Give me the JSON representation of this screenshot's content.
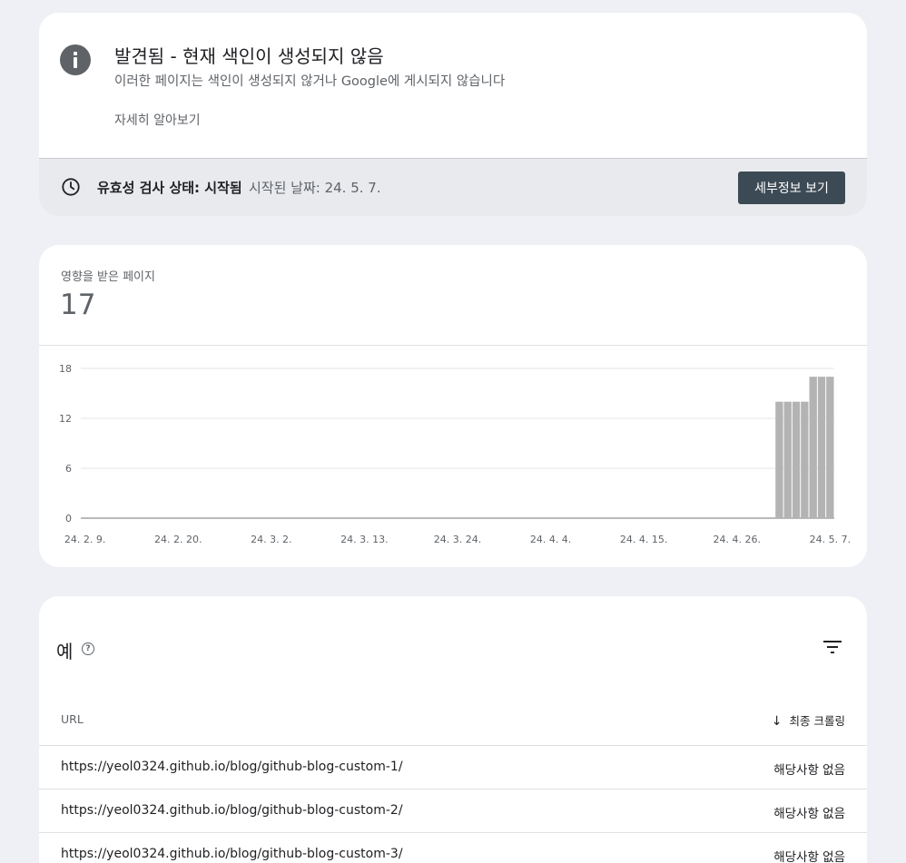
{
  "status_card": {
    "title": "발견됨 - 현재 색인이 생성되지 않음",
    "subtitle": "이러한 페이지는 색인이 생성되지 않거나 Google에 게시되지 않습니다",
    "learn_more": "자세히 알아보기",
    "validation_label": "유효성 검사 상태: 시작됨",
    "validation_date": "시작된 날짜: 24. 5. 7.",
    "details_button": "세부정보 보기"
  },
  "affected": {
    "label": "영향을 받은 페이지",
    "value": "17"
  },
  "chart_data": {
    "type": "bar",
    "title": "",
    "xlabel": "",
    "ylabel": "",
    "ylim": [
      0,
      18
    ],
    "yticks": [
      "18",
      "12",
      "6",
      "0"
    ],
    "x_tick_labels": [
      "24. 2. 9.",
      "24. 2. 20.",
      "24. 3. 2.",
      "24. 3. 13.",
      "24. 3. 24.",
      "24. 4. 4.",
      "24. 4. 15.",
      "24. 4. 26.",
      "24. 5. 7."
    ],
    "x_start": "24. 2. 9.",
    "x_end": "24. 5. 7.",
    "bars": [
      {
        "date": "24. 5. 1.",
        "value": 14
      },
      {
        "date": "24. 5. 2.",
        "value": 14
      },
      {
        "date": "24. 5. 3.",
        "value": 14
      },
      {
        "date": "24. 5. 4.",
        "value": 14
      },
      {
        "date": "24. 5. 5.",
        "value": 17
      },
      {
        "date": "24. 5. 6.",
        "value": 17
      },
      {
        "date": "24. 5. 7.",
        "value": 17
      }
    ],
    "bar_color": "#b3b3b3",
    "grid": true
  },
  "examples": {
    "title": "예",
    "help_icon": "help-icon",
    "filter_icon": "filter-icon",
    "col_url": "URL",
    "col_crawl": "최종 크롤링",
    "rows": [
      {
        "url": "https://yeol0324.github.io/blog/github-blog-custom-1/",
        "crawl": "해당사항 없음"
      },
      {
        "url": "https://yeol0324.github.io/blog/github-blog-custom-2/",
        "crawl": "해당사항 없음"
      },
      {
        "url": "https://yeol0324.github.io/blog/github-blog-custom-3/",
        "crawl": "해당사항 없음"
      }
    ]
  }
}
